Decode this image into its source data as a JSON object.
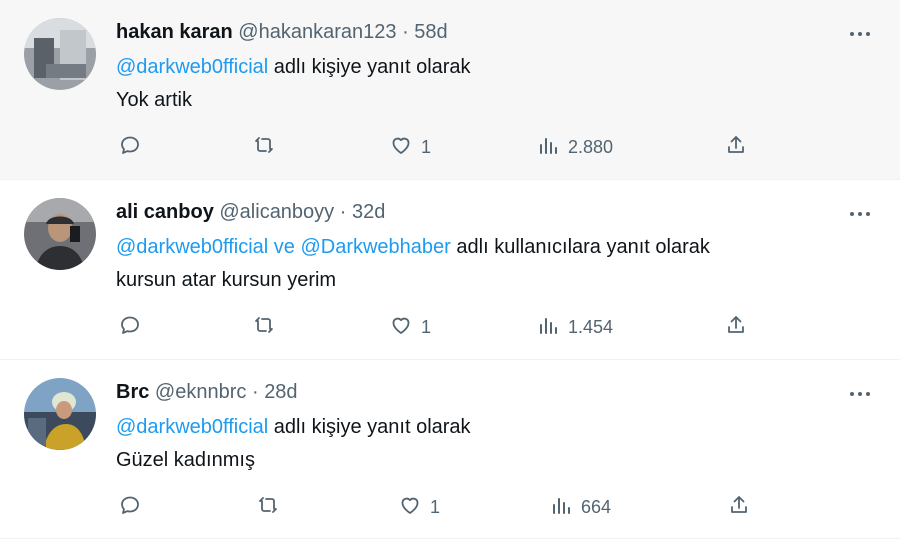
{
  "tweets": [
    {
      "name": "hakan karan",
      "handle": "@hakankaran123",
      "dot": "·",
      "time": "58d",
      "reply_mentions": "@darkweb0fficial",
      "reply_suffix": " adlı kişiye yanıt olarak",
      "text": "Yok artik",
      "likes": "1",
      "views": "2.880",
      "avatar_colors": [
        "#8a8f96",
        "#d9dde1",
        "#5a6169"
      ]
    },
    {
      "name": "ali canboy",
      "handle": "@alicanboyy",
      "dot": "·",
      "time": "32d",
      "reply_mentions": "@darkweb0fficial ve @Darkwebhaber",
      "reply_suffix": " adlı kullanıcılara yanıt olarak",
      "text": "kursun atar kursun yerim",
      "likes": "1",
      "views": "1.454",
      "avatar_colors": [
        "#2e2f33",
        "#6f7076",
        "#b9b2a6"
      ]
    },
    {
      "name": "Brc",
      "handle": "@eknnbrc",
      "dot": "·",
      "time": "28d",
      "reply_mentions": "@darkweb0fficial",
      "reply_suffix": " adlı kişiye yanıt olarak",
      "text": "Güzel kadınmış",
      "likes": "1",
      "views": "664",
      "avatar_colors": [
        "#c9a227",
        "#e8d27a",
        "#3d4a5e"
      ]
    }
  ],
  "icons": {
    "reply": "reply-icon",
    "retweet": "retweet-icon",
    "like": "heart-icon",
    "views": "views-icon",
    "share": "share-icon",
    "more": "more-icon"
  },
  "colors": {
    "link": "#1d9bf0",
    "muted": "#536471",
    "text": "#0f1419",
    "hover_bg": "#f7f7f7"
  }
}
